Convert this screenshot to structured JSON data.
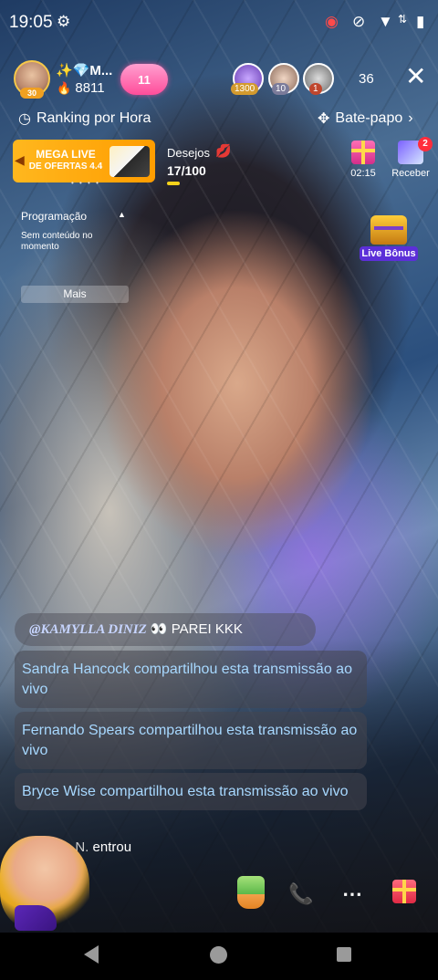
{
  "status_bar": {
    "time": "19:05",
    "icons": [
      "settings-gear-icon",
      "record-icon",
      "vibrate-off-icon",
      "wifi-icon",
      "data-arrows-icon",
      "battery-icon"
    ]
  },
  "host": {
    "level": "30",
    "name": "✨💎M...",
    "fans": "8811",
    "badge": "11"
  },
  "viewers": {
    "top": [
      {
        "badge": "1300",
        "badge_color": "#d39a2e"
      },
      {
        "badge": "10",
        "badge_color": "#7b7b9a"
      },
      {
        "badge": "1",
        "badge_color": "#c0462d"
      }
    ],
    "count": "36"
  },
  "ranking": {
    "label": "Ranking por Hora"
  },
  "chat_tab": {
    "label": "Bate-papo"
  },
  "mega_live": {
    "title_line1": "MEGA LIVE",
    "title_line2": "DE OFERTAS 4.4"
  },
  "wishes": {
    "label": "Desejos",
    "count": "17/100",
    "progress": 0.17
  },
  "gift_timer": {
    "time": "02:15"
  },
  "receive": {
    "label": "Receber",
    "badge": "2"
  },
  "schedule": {
    "title": "Programação",
    "empty_text": "Sem conteúdo no momento",
    "more_label": "Mais"
  },
  "live_bonus": {
    "label": "Live Bônus"
  },
  "chat": {
    "mention_name": "@KAMYLLA DINIZ",
    "mention_emoji": "👀",
    "mention_text": "PAREI KKK",
    "messages": [
      "Sandra Hancock compartilhou esta transmissão ao vivo",
      "Fernando Spears compartilhou esta transmissão ao vivo",
      "Bryce Wise compartilhou esta transmissão ao vivo"
    ],
    "entered_name": "van N.",
    "entered_text": "entrou"
  },
  "colors": {
    "accent_pink": "#ff4d9a",
    "chat_blue": "#a7d8ff",
    "mega_orange": "#ffb71e"
  }
}
